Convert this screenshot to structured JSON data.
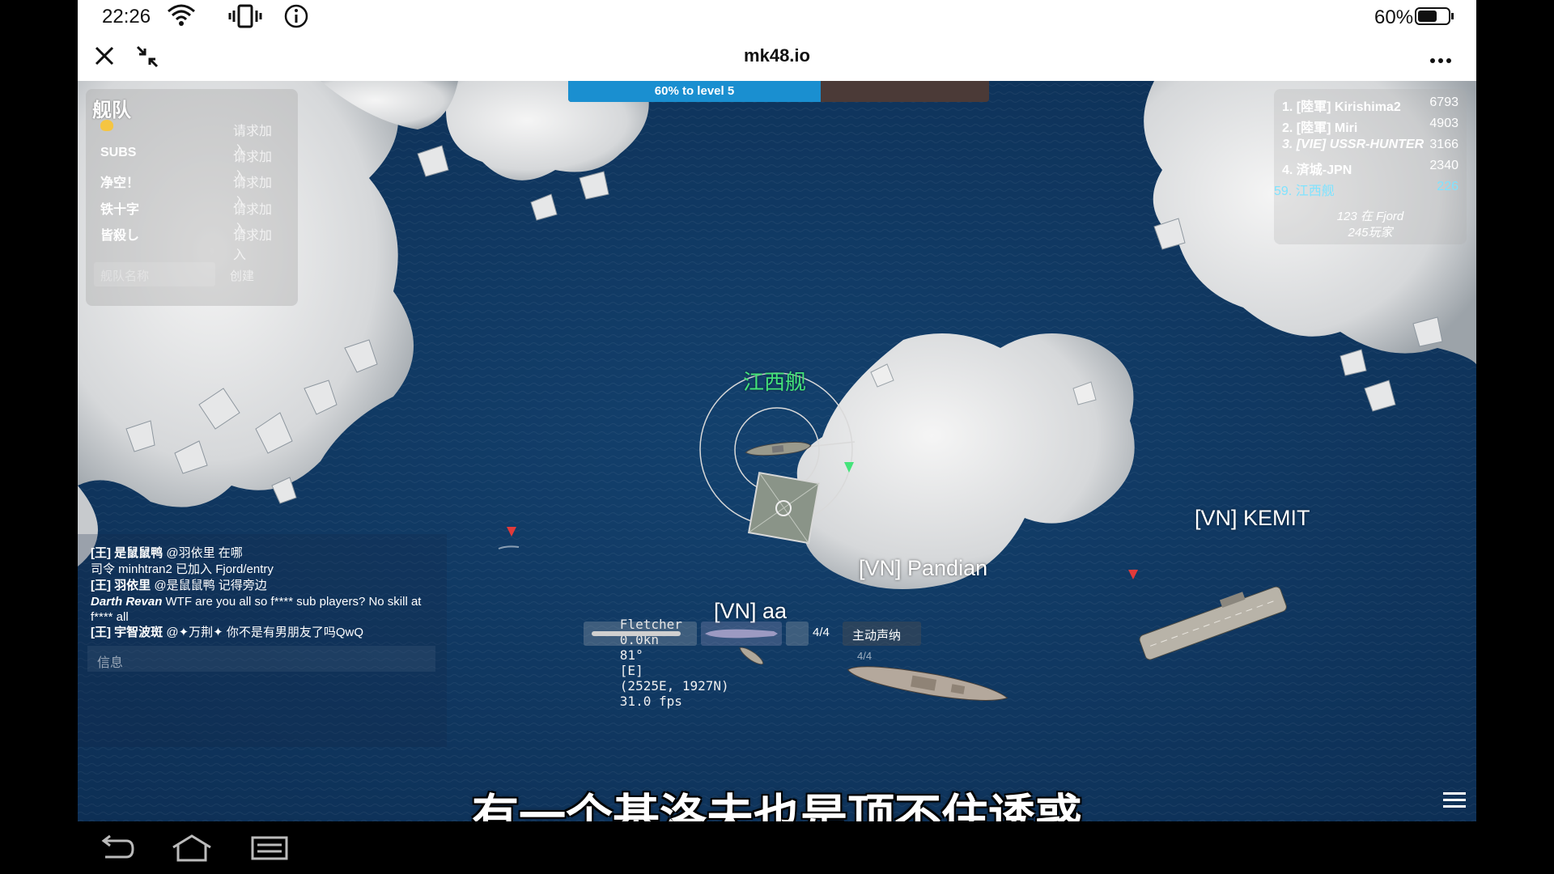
{
  "status_bar": {
    "time": "22:26",
    "battery_percent": "60%",
    "icons": [
      "wifi-icon",
      "vibrate-icon",
      "info-icon",
      "battery-icon"
    ]
  },
  "browser": {
    "title": "mk48.io",
    "icons": [
      "close-icon",
      "exit-fullscreen-icon",
      "more-icon"
    ]
  },
  "progress": {
    "label": "60% to level 5",
    "fraction": 0.6,
    "color": "#1a8fd0"
  },
  "fleet_panel": {
    "title": "舰队",
    "rows": [
      {
        "name": "",
        "action": "请求加入"
      },
      {
        "name": "SUBS",
        "action": "请求加入"
      },
      {
        "name": "净空！",
        "action": "请求加入"
      },
      {
        "name": "铁十字",
        "action": "请求加入"
      },
      {
        "name": "皆殺し",
        "action": "请求加入"
      }
    ],
    "input_placeholder": "舰队名称",
    "create_label": "创建"
  },
  "leaderboard": {
    "rows": [
      {
        "rank": "1.",
        "name": "[陸軍] Kirishima2",
        "score": "6793"
      },
      {
        "rank": "2.",
        "name": "[陸軍] Miri",
        "score": "4903"
      },
      {
        "rank": "3.",
        "name": "[VIE] USSR-HUNTER",
        "score": "3166"
      },
      {
        "rank": "4.",
        "name": "済城-JPN",
        "score": "2340"
      },
      {
        "rank": "59.",
        "name": "江西舰",
        "score": "226",
        "self": true
      }
    ],
    "footer_line1": "123 在 Fjord",
    "footer_line2": "245玩家"
  },
  "ships": {
    "player": "江西舰",
    "others": [
      "[VN] Pandian",
      "[VN] KEMIT",
      "[VN] aa"
    ]
  },
  "chat": {
    "lines": [
      {
        "name": "[王] 是鼠鼠鸭",
        "text": " @羽依里 在哪"
      },
      {
        "name": "",
        "text": "司令 minhtran2 已加入 Fjord/entry"
      },
      {
        "name": "[王] 羽依里",
        "text": " @是鼠鼠鸭 记得旁边"
      },
      {
        "name": "Darth Revan",
        "text": " WTF are you all so f**** sub players? No skill at f**** all"
      },
      {
        "name": "[王] 宇智波斑",
        "text": " @✦万荆✦ 你不是有男朋友了吗QwQ"
      }
    ],
    "input_placeholder": "信息"
  },
  "status_line": {
    "ship": "Fletcher",
    "speed": "0.0kn",
    "heading": "81°",
    "direction": "[E]",
    "position": "(2525E, 1927N)",
    "fps": "31.0 fps"
  },
  "weapons": {
    "torpedo_count": "4/4",
    "sonar_label": "主动声纳",
    "secondary_count": "4/4"
  },
  "subtitle": "有一个基洛夫也是顶不住诱惑",
  "colors": {
    "ocean": "#0f3760",
    "player_green": "#44e37a",
    "enemy_red": "#e23a3a",
    "progress_blue": "#1a8fd0"
  }
}
